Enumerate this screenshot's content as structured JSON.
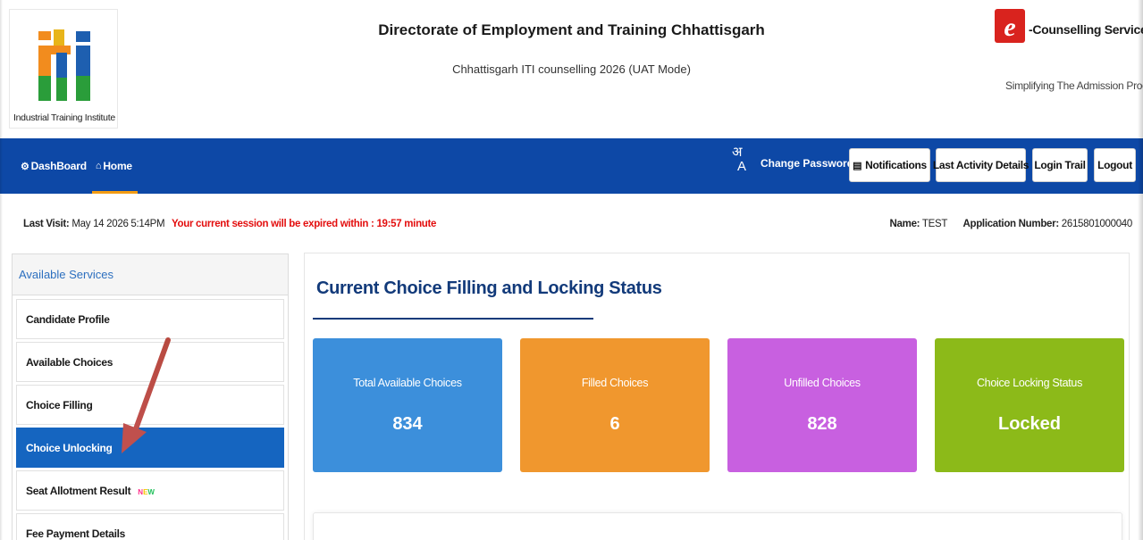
{
  "header": {
    "logo_text": "Industrial Training Institute",
    "title": "Directorate of Employment and Training Chhattisgarh",
    "subtitle": "Chhattisgarh ITI counselling 2026 (UAT Mode)",
    "brand_name": "-Counselling Services",
    "brand_tagline": "Simplifying The Admission Process"
  },
  "nav": {
    "items": [
      {
        "label": "DashBoard",
        "icon": "dashboard-icon"
      },
      {
        "label": "Home",
        "icon": "home-icon"
      }
    ],
    "lang_top": "अ",
    "lang_bottom": "A",
    "change_password": "Change Password ▾",
    "notifications": "Notifications",
    "last_activity": "Last Activity Details",
    "login_trail": "Login Trail",
    "logout": "Logout",
    "bg_color": "#0d48a6"
  },
  "info": {
    "last_visit_label": "Last Visit:",
    "last_visit_value": " May 14 2026 5:14PM",
    "session_warning": "Your current session will be expired within : 19:57 minute",
    "name_label": "Name:",
    "name_value": " TEST",
    "app_label": "Application Number:",
    "app_value": " 2615801000040"
  },
  "sidebar": {
    "heading": "Available Services",
    "items": [
      {
        "label": "Candidate Profile"
      },
      {
        "label": "Available Choices"
      },
      {
        "label": "Choice Filling"
      },
      {
        "label": "Choice Unlocking",
        "active": true
      },
      {
        "label": "Seat Allotment Result",
        "badge": "NEW"
      },
      {
        "label": "Fee Payment Details"
      }
    ]
  },
  "main": {
    "title": "Current Choice Filling and Locking Status",
    "cards": [
      {
        "label": "Total Available Choices",
        "value": "834",
        "color": "#3c8fdb"
      },
      {
        "label": "Filled Choices",
        "value": "6",
        "color": "#f0972e"
      },
      {
        "label": "Unfilled Choices",
        "value": "828",
        "color": "#c860e0"
      },
      {
        "label": "Choice Locking Status",
        "value": "Locked",
        "color": "#8cba19"
      }
    ]
  }
}
